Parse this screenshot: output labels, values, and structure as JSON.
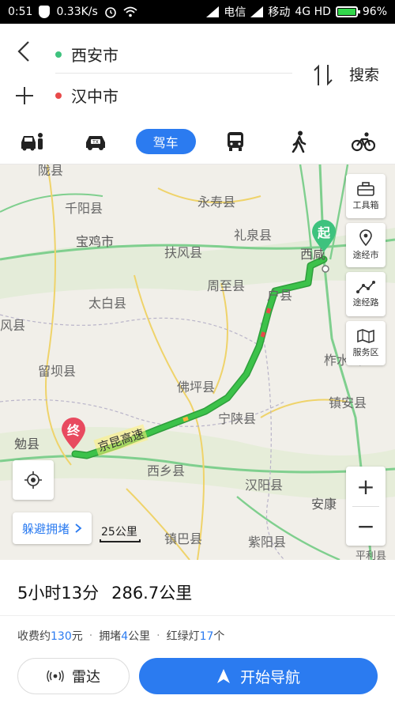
{
  "status_bar": {
    "time": "0:51",
    "speed": "0.33K/s",
    "carrier1": "电信",
    "carrier2": "移动",
    "network": "4G HD",
    "battery": "96%"
  },
  "route": {
    "origin": "西安市",
    "destination": "汉中市",
    "search_label": "搜索",
    "origin_color": "#3ec27e",
    "destination_color": "#e84a4a"
  },
  "modes": {
    "active_label": "驾车"
  },
  "map": {
    "places": [
      "陇县",
      "千阳县",
      "永寿县",
      "宝鸡市",
      "礼泉县",
      "西咸",
      "扶风县",
      "周至县",
      "户县",
      "太白县",
      "风县",
      "柞水县",
      "留坝县",
      "佛坪县",
      "镇安县",
      "宁陕县",
      "勉县",
      "西乡县",
      "汉阳县",
      "安康",
      "镇巴县",
      "紫阳县",
      "平利县"
    ],
    "road_label": "京昆高速",
    "start_marker": "起",
    "end_marker": "终",
    "route_color": "#3cc24a",
    "tools": {
      "toolbox": "工具箱",
      "via_city": "途经市",
      "via_road": "途经路",
      "service": "服务区"
    },
    "avoid_label": "躲避拥堵",
    "scale_label": "25公里",
    "zoom_in": "+",
    "zoom_out": "−"
  },
  "summary": {
    "duration": "5小时13分",
    "distance": "286.7公里",
    "toll_prefix": "收费约",
    "toll_value": "130",
    "toll_unit": "元",
    "jam_prefix": "拥堵",
    "jam_value": "4",
    "jam_unit": "公里",
    "lights_prefix": "红绿灯",
    "lights_value": "17",
    "lights_unit": "个",
    "separator": "·",
    "radar_label": "雷达",
    "navigate_label": "开始导航"
  }
}
